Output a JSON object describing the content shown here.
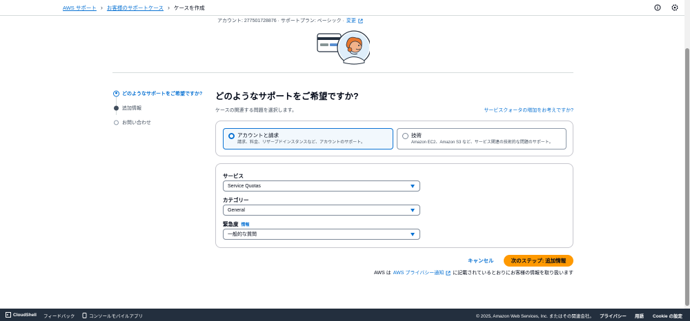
{
  "breadcrumb": {
    "items": [
      "AWS サポート",
      "お客様のサポートケース"
    ],
    "current": "ケースを作成"
  },
  "header_icons": [
    "info-circle-icon",
    "settings-icon"
  ],
  "account": {
    "text": "アカウント: 277501728876 · サポートプラン: ベーシック ·",
    "change_link": "変更"
  },
  "steps": [
    {
      "label": "どのようなサポートをご希望ですか?",
      "state": "active"
    },
    {
      "label": "追加情報",
      "state": "done"
    },
    {
      "label": "お問い合わせ",
      "state": "pending"
    }
  ],
  "main": {
    "title": "どのようなサポートをご希望ですか?",
    "subtitle": "ケースの関連する問題を選択します。",
    "quota_link": "サービスクォータの増加をお考えですか?"
  },
  "support_types": [
    {
      "title": "アカウントと請求",
      "desc": "請求、料金、リザーブドインスタンスなど、アカウントのサポート。",
      "selected": true
    },
    {
      "title": "技術",
      "desc": "Amazon EC2、Amazon S3 など、サービス関連の技術的な問題のサポート。",
      "selected": false
    }
  ],
  "form": {
    "service": {
      "label": "サービス",
      "value": "Service Quotas"
    },
    "category": {
      "label": "カテゴリー",
      "value": "General"
    },
    "severity": {
      "label": "緊急度",
      "info": "情報",
      "value": "一般的な質問"
    }
  },
  "actions": {
    "cancel": "キャンセル",
    "next": "次のステップ: 追加情報"
  },
  "privacy": {
    "prefix": "AWS は",
    "link": "AWS プライバシー通知",
    "suffix": "に記載されているとおりにお客様の情報を取り扱います"
  },
  "footer": {
    "cloudshell": "CloudShell",
    "feedback": "フィードバック",
    "mobile_app": "コンソールモバイルアプリ",
    "copyright": "© 2025, Amazon Web Services, Inc. またはその関連会社。",
    "privacy": "プライバシー",
    "terms": "用語",
    "cookie": "Cookie の設定"
  },
  "colors": {
    "link": "#0972d3",
    "primary_button": "#ff9900",
    "footer_bg": "#232f3e"
  }
}
